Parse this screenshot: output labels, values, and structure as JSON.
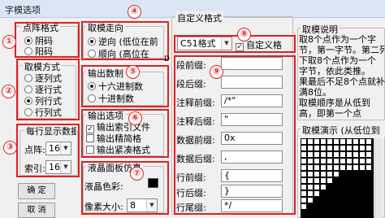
{
  "window": {
    "title": "字模选项"
  },
  "badges": {
    "b1": "①",
    "b2": "②",
    "b3": "③",
    "b4": "④",
    "b5": "⑤",
    "b6": "⑥",
    "b7": "⑦",
    "b8": "⑧",
    "b9": "⑨"
  },
  "dot_format": {
    "legend": "点阵格式",
    "options": [
      "阴码",
      "阳码"
    ],
    "selected": 0
  },
  "scan_mode": {
    "legend": "取模方式",
    "options": [
      "逐列式",
      "逐行式",
      "列行式",
      "行列式"
    ],
    "selected": 2
  },
  "per_line": {
    "legend": "每行显示数据",
    "points_label": "点阵:",
    "points_value": "16",
    "index_label": "索引:",
    "index_value": "16"
  },
  "buttons": {
    "ok": "确    定",
    "cancel": "取    消"
  },
  "direction": {
    "legend": "取模走向",
    "options": [
      "逆向 (低位在前",
      "顺向 (高位在"
    ],
    "selected": 0,
    "clip_text": "D"
  },
  "radix": {
    "legend": "输出数制",
    "options": [
      "十六进制数",
      "十进制数"
    ],
    "selected": 0
  },
  "output_options": {
    "legend": "输出选项",
    "items": [
      {
        "label": "输出索引文件",
        "checked": true
      },
      {
        "label": "输出精简格",
        "checked": false
      },
      {
        "label": "输出紧凑格式",
        "checked": false
      }
    ]
  },
  "lcd_sim": {
    "legend": "液晶面板仿真",
    "color_label": "液晶色彩:",
    "pixel_label": "像素大小:",
    "pixel_value": "8"
  },
  "custom_format": {
    "legend": "自定义格式",
    "format_value": "C51格式",
    "custom_check_label": "自定义格",
    "custom_checked": true,
    "fields": [
      {
        "label": "段前缀:",
        "value": ""
      },
      {
        "label": "段后缀:",
        "value": ""
      },
      {
        "label": "注释前缀:",
        "value": "/*\""
      },
      {
        "label": "注释后缀:",
        "value": "\""
      },
      {
        "label": "数据前缀:",
        "value": "0x"
      },
      {
        "label": "数据后缀:",
        "value": ","
      },
      {
        "label": "行前缀:",
        "value": "{"
      },
      {
        "label": "行后缀:",
        "value": "}"
      },
      {
        "label": "行尾缀:",
        "value": "*/"
      }
    ]
  },
  "help": {
    "legend": "取模说明",
    "text": "取8个点作为一个字\n节，第一字节。第二列开始\n下取8个点作为一个\n字节，依此类推。\n果最后不足8个点就补\n满8位。\n取模顺序是从低到\n高，即第一个点"
  },
  "preview": {
    "legend": "取模演示 (从低位到"
  },
  "colors": {
    "accent_red": "#e02020",
    "lcd_color": "#000000"
  }
}
